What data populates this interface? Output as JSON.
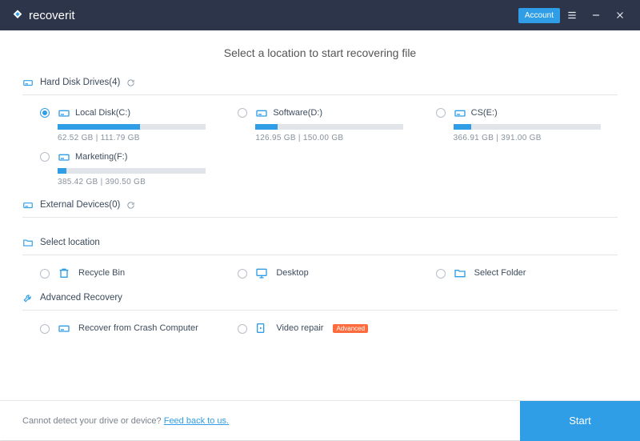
{
  "app": {
    "name": "recoverit",
    "account_label": "Account"
  },
  "headline": "Select a location to start recovering file",
  "sections": {
    "hdd": {
      "label": "Hard Disk Drives(4)"
    },
    "ext": {
      "label": "External Devices(0)"
    },
    "loc": {
      "label": "Select location"
    },
    "adv": {
      "label": "Advanced Recovery"
    }
  },
  "drives": [
    {
      "name": "Local Disk(C:)",
      "usage": "62.52  GB | 111.79  GB",
      "fill": 56,
      "selected": true
    },
    {
      "name": "Software(D:)",
      "usage": "126.95  GB | 150.00  GB",
      "fill": 15,
      "selected": false
    },
    {
      "name": "CS(E:)",
      "usage": "366.91  GB | 391.00  GB",
      "fill": 12,
      "selected": false
    },
    {
      "name": "Marketing(F:)",
      "usage": "385.42  GB | 390.50  GB",
      "fill": 6,
      "selected": false
    }
  ],
  "locations": [
    {
      "name": "Recycle Bin",
      "icon": "recycle"
    },
    {
      "name": "Desktop",
      "icon": "desktop"
    },
    {
      "name": "Select Folder",
      "icon": "folder"
    }
  ],
  "advanced": [
    {
      "name": "Recover from Crash Computer",
      "icon": "drive",
      "badge": null
    },
    {
      "name": "Video repair",
      "icon": "video",
      "badge": "Advanced"
    }
  ],
  "footer": {
    "text": "Cannot detect your drive or device? ",
    "link": "Feed back to us.",
    "start": "Start"
  }
}
